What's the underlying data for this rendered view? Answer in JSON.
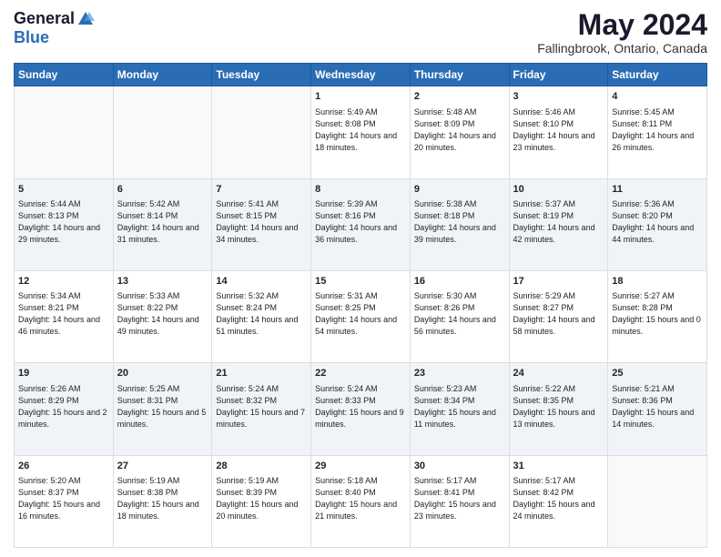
{
  "logo": {
    "general": "General",
    "blue": "Blue"
  },
  "title": "May 2024",
  "location": "Fallingbrook, Ontario, Canada",
  "days_of_week": [
    "Sunday",
    "Monday",
    "Tuesday",
    "Wednesday",
    "Thursday",
    "Friday",
    "Saturday"
  ],
  "weeks": [
    [
      {
        "day": "",
        "sunrise": "",
        "sunset": "",
        "daylight": "",
        "empty": true
      },
      {
        "day": "",
        "sunrise": "",
        "sunset": "",
        "daylight": "",
        "empty": true
      },
      {
        "day": "",
        "sunrise": "",
        "sunset": "",
        "daylight": "",
        "empty": true
      },
      {
        "day": "1",
        "sunrise": "Sunrise: 5:49 AM",
        "sunset": "Sunset: 8:08 PM",
        "daylight": "Daylight: 14 hours and 18 minutes.",
        "empty": false
      },
      {
        "day": "2",
        "sunrise": "Sunrise: 5:48 AM",
        "sunset": "Sunset: 8:09 PM",
        "daylight": "Daylight: 14 hours and 20 minutes.",
        "empty": false
      },
      {
        "day": "3",
        "sunrise": "Sunrise: 5:46 AM",
        "sunset": "Sunset: 8:10 PM",
        "daylight": "Daylight: 14 hours and 23 minutes.",
        "empty": false
      },
      {
        "day": "4",
        "sunrise": "Sunrise: 5:45 AM",
        "sunset": "Sunset: 8:11 PM",
        "daylight": "Daylight: 14 hours and 26 minutes.",
        "empty": false
      }
    ],
    [
      {
        "day": "5",
        "sunrise": "Sunrise: 5:44 AM",
        "sunset": "Sunset: 8:13 PM",
        "daylight": "Daylight: 14 hours and 29 minutes.",
        "empty": false
      },
      {
        "day": "6",
        "sunrise": "Sunrise: 5:42 AM",
        "sunset": "Sunset: 8:14 PM",
        "daylight": "Daylight: 14 hours and 31 minutes.",
        "empty": false
      },
      {
        "day": "7",
        "sunrise": "Sunrise: 5:41 AM",
        "sunset": "Sunset: 8:15 PM",
        "daylight": "Daylight: 14 hours and 34 minutes.",
        "empty": false
      },
      {
        "day": "8",
        "sunrise": "Sunrise: 5:39 AM",
        "sunset": "Sunset: 8:16 PM",
        "daylight": "Daylight: 14 hours and 36 minutes.",
        "empty": false
      },
      {
        "day": "9",
        "sunrise": "Sunrise: 5:38 AM",
        "sunset": "Sunset: 8:18 PM",
        "daylight": "Daylight: 14 hours and 39 minutes.",
        "empty": false
      },
      {
        "day": "10",
        "sunrise": "Sunrise: 5:37 AM",
        "sunset": "Sunset: 8:19 PM",
        "daylight": "Daylight: 14 hours and 42 minutes.",
        "empty": false
      },
      {
        "day": "11",
        "sunrise": "Sunrise: 5:36 AM",
        "sunset": "Sunset: 8:20 PM",
        "daylight": "Daylight: 14 hours and 44 minutes.",
        "empty": false
      }
    ],
    [
      {
        "day": "12",
        "sunrise": "Sunrise: 5:34 AM",
        "sunset": "Sunset: 8:21 PM",
        "daylight": "Daylight: 14 hours and 46 minutes.",
        "empty": false
      },
      {
        "day": "13",
        "sunrise": "Sunrise: 5:33 AM",
        "sunset": "Sunset: 8:22 PM",
        "daylight": "Daylight: 14 hours and 49 minutes.",
        "empty": false
      },
      {
        "day": "14",
        "sunrise": "Sunrise: 5:32 AM",
        "sunset": "Sunset: 8:24 PM",
        "daylight": "Daylight: 14 hours and 51 minutes.",
        "empty": false
      },
      {
        "day": "15",
        "sunrise": "Sunrise: 5:31 AM",
        "sunset": "Sunset: 8:25 PM",
        "daylight": "Daylight: 14 hours and 54 minutes.",
        "empty": false
      },
      {
        "day": "16",
        "sunrise": "Sunrise: 5:30 AM",
        "sunset": "Sunset: 8:26 PM",
        "daylight": "Daylight: 14 hours and 56 minutes.",
        "empty": false
      },
      {
        "day": "17",
        "sunrise": "Sunrise: 5:29 AM",
        "sunset": "Sunset: 8:27 PM",
        "daylight": "Daylight: 14 hours and 58 minutes.",
        "empty": false
      },
      {
        "day": "18",
        "sunrise": "Sunrise: 5:27 AM",
        "sunset": "Sunset: 8:28 PM",
        "daylight": "Daylight: 15 hours and 0 minutes.",
        "empty": false
      }
    ],
    [
      {
        "day": "19",
        "sunrise": "Sunrise: 5:26 AM",
        "sunset": "Sunset: 8:29 PM",
        "daylight": "Daylight: 15 hours and 2 minutes.",
        "empty": false
      },
      {
        "day": "20",
        "sunrise": "Sunrise: 5:25 AM",
        "sunset": "Sunset: 8:31 PM",
        "daylight": "Daylight: 15 hours and 5 minutes.",
        "empty": false
      },
      {
        "day": "21",
        "sunrise": "Sunrise: 5:24 AM",
        "sunset": "Sunset: 8:32 PM",
        "daylight": "Daylight: 15 hours and 7 minutes.",
        "empty": false
      },
      {
        "day": "22",
        "sunrise": "Sunrise: 5:24 AM",
        "sunset": "Sunset: 8:33 PM",
        "daylight": "Daylight: 15 hours and 9 minutes.",
        "empty": false
      },
      {
        "day": "23",
        "sunrise": "Sunrise: 5:23 AM",
        "sunset": "Sunset: 8:34 PM",
        "daylight": "Daylight: 15 hours and 11 minutes.",
        "empty": false
      },
      {
        "day": "24",
        "sunrise": "Sunrise: 5:22 AM",
        "sunset": "Sunset: 8:35 PM",
        "daylight": "Daylight: 15 hours and 13 minutes.",
        "empty": false
      },
      {
        "day": "25",
        "sunrise": "Sunrise: 5:21 AM",
        "sunset": "Sunset: 8:36 PM",
        "daylight": "Daylight: 15 hours and 14 minutes.",
        "empty": false
      }
    ],
    [
      {
        "day": "26",
        "sunrise": "Sunrise: 5:20 AM",
        "sunset": "Sunset: 8:37 PM",
        "daylight": "Daylight: 15 hours and 16 minutes.",
        "empty": false
      },
      {
        "day": "27",
        "sunrise": "Sunrise: 5:19 AM",
        "sunset": "Sunset: 8:38 PM",
        "daylight": "Daylight: 15 hours and 18 minutes.",
        "empty": false
      },
      {
        "day": "28",
        "sunrise": "Sunrise: 5:19 AM",
        "sunset": "Sunset: 8:39 PM",
        "daylight": "Daylight: 15 hours and 20 minutes.",
        "empty": false
      },
      {
        "day": "29",
        "sunrise": "Sunrise: 5:18 AM",
        "sunset": "Sunset: 8:40 PM",
        "daylight": "Daylight: 15 hours and 21 minutes.",
        "empty": false
      },
      {
        "day": "30",
        "sunrise": "Sunrise: 5:17 AM",
        "sunset": "Sunset: 8:41 PM",
        "daylight": "Daylight: 15 hours and 23 minutes.",
        "empty": false
      },
      {
        "day": "31",
        "sunrise": "Sunrise: 5:17 AM",
        "sunset": "Sunset: 8:42 PM",
        "daylight": "Daylight: 15 hours and 24 minutes.",
        "empty": false
      },
      {
        "day": "",
        "sunrise": "",
        "sunset": "",
        "daylight": "",
        "empty": true
      }
    ]
  ]
}
